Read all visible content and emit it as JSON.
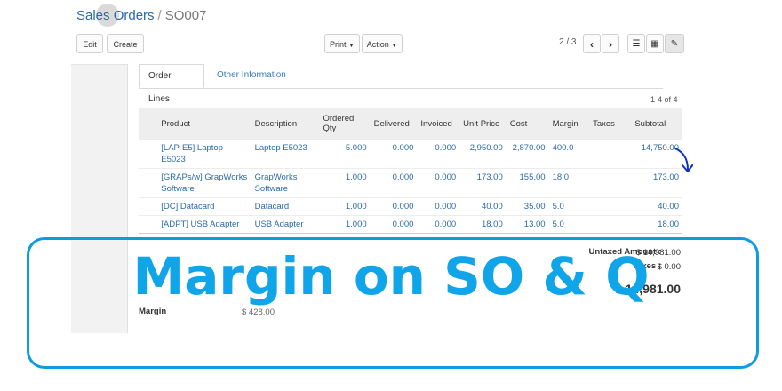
{
  "breadcrumb": {
    "parent": "Sales Orders",
    "separator": "/",
    "current": "SO007"
  },
  "toolbar": {
    "edit_label": "Edit",
    "create_label": "Create",
    "print_label": "Print",
    "action_label": "Action",
    "pager": "2 / 3"
  },
  "tabs": [
    {
      "label": "Order Lines"
    },
    {
      "label": "Other Information"
    }
  ],
  "record_count": "1-4 of 4",
  "table": {
    "headers": [
      "Product",
      "Description",
      "Ordered Qty",
      "Delivered",
      "Invoiced",
      "Unit Price",
      "Cost",
      "Margin",
      "Taxes",
      "Subtotal"
    ],
    "rows": [
      {
        "product": "[LAP-E5] Laptop E5023",
        "description": "Laptop E5023",
        "qty": "5.000",
        "delivered": "0.000",
        "invoiced": "0.000",
        "unit_price": "2,950.00",
        "cost": "2,870.00",
        "margin": "400.0",
        "taxes": "",
        "subtotal": "14,750.00"
      },
      {
        "product": "[GRAPs/w] GrapWorks Software",
        "description": "GrapWorks Software",
        "qty": "1.000",
        "delivered": "0.000",
        "invoiced": "0.000",
        "unit_price": "173.00",
        "cost": "155.00",
        "margin": "18.0",
        "taxes": "",
        "subtotal": "173.00"
      },
      {
        "product": "[DC] Datacard",
        "description": "Datacard",
        "qty": "1.000",
        "delivered": "0.000",
        "invoiced": "0.000",
        "unit_price": "40.00",
        "cost": "35.00",
        "margin": "5.0",
        "taxes": "",
        "subtotal": "40.00"
      },
      {
        "product": "[ADPT] USB Adapter",
        "description": "USB Adapter",
        "qty": "1.000",
        "delivered": "0.000",
        "invoiced": "0.000",
        "unit_price": "18.00",
        "cost": "13.00",
        "margin": "5.0",
        "taxes": "",
        "subtotal": "18.00"
      }
    ]
  },
  "totals": {
    "untaxed_label": "Untaxed Amount :",
    "untaxed_value": "$ 14,981.00",
    "taxes_label": "Taxes :",
    "taxes_value": "$ 0.00",
    "total_label": "Total :",
    "total_value": "$ 14,981.00"
  },
  "margin": {
    "label": "Margin",
    "value": "$ 428.00"
  },
  "overlay": {
    "title": "Margin on SO & Q",
    "color": "#10a4e8"
  }
}
